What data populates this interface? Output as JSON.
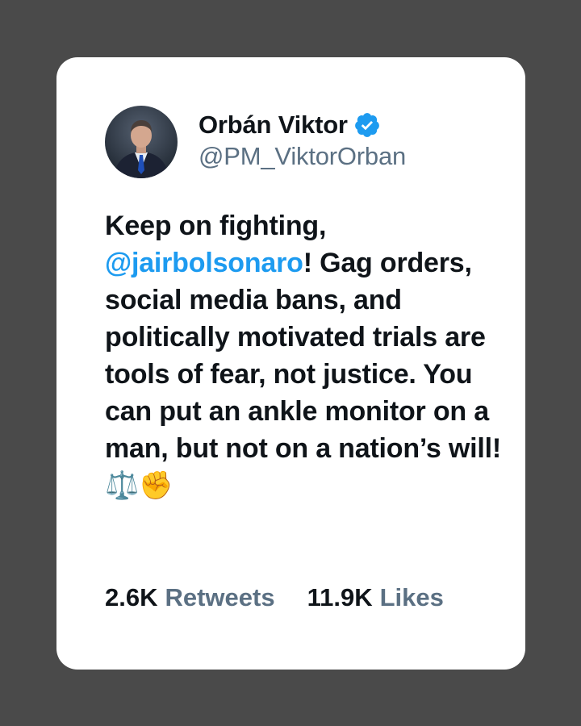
{
  "tweet": {
    "author": {
      "name": "Orbán Viktor",
      "handle": "@PM_ViktorOrban",
      "verified": true,
      "avatar_icon": "person-portrait-icon"
    },
    "text_segments": [
      {
        "text": "Keep on fighting, ",
        "type": "plain"
      },
      {
        "text": "@jairbolsonaro",
        "type": "mention"
      },
      {
        "text": "! Gag orders, social media bans, and politically motivated trials are tools of fear, not justice. You can put an ankle monitor on a man, but not on a nation’s will! ",
        "type": "plain"
      },
      {
        "text": "⚖️✊",
        "type": "emoji"
      }
    ],
    "stats": {
      "retweets_count": "2.6K",
      "retweets_label": "Retweets",
      "likes_count": "11.9K",
      "likes_label": "Likes"
    }
  },
  "colors": {
    "background": "#4a4a4a",
    "card": "#ffffff",
    "text": "#0f1419",
    "secondary": "#5b7083",
    "mention": "#1d9bf0",
    "verified": "#1d9bf0"
  }
}
